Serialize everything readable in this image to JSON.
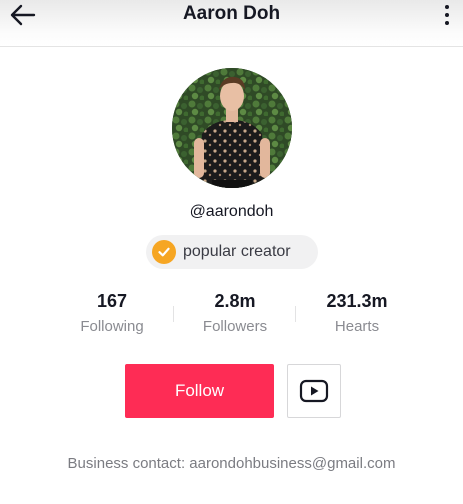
{
  "header": {
    "title": "Aaron Doh",
    "back_icon": "arrow-left-icon",
    "more_icon": "more-vertical-icon"
  },
  "profile": {
    "avatar_icon": "profile-photo",
    "username": "@aarondoh",
    "badge": {
      "icon": "checkmark-badge-icon",
      "label": "popular creator",
      "color": "#f6a623"
    }
  },
  "stats": [
    {
      "value": "167",
      "label": "Following"
    },
    {
      "value": "2.8m",
      "label": "Followers"
    },
    {
      "value": "231.3m",
      "label": "Hearts"
    }
  ],
  "actions": {
    "follow_label": "Follow",
    "follow_color": "#fe2c55",
    "video_icon": "youtube-play-icon"
  },
  "bio": "Business contact: aarondohbusiness@gmail.com"
}
